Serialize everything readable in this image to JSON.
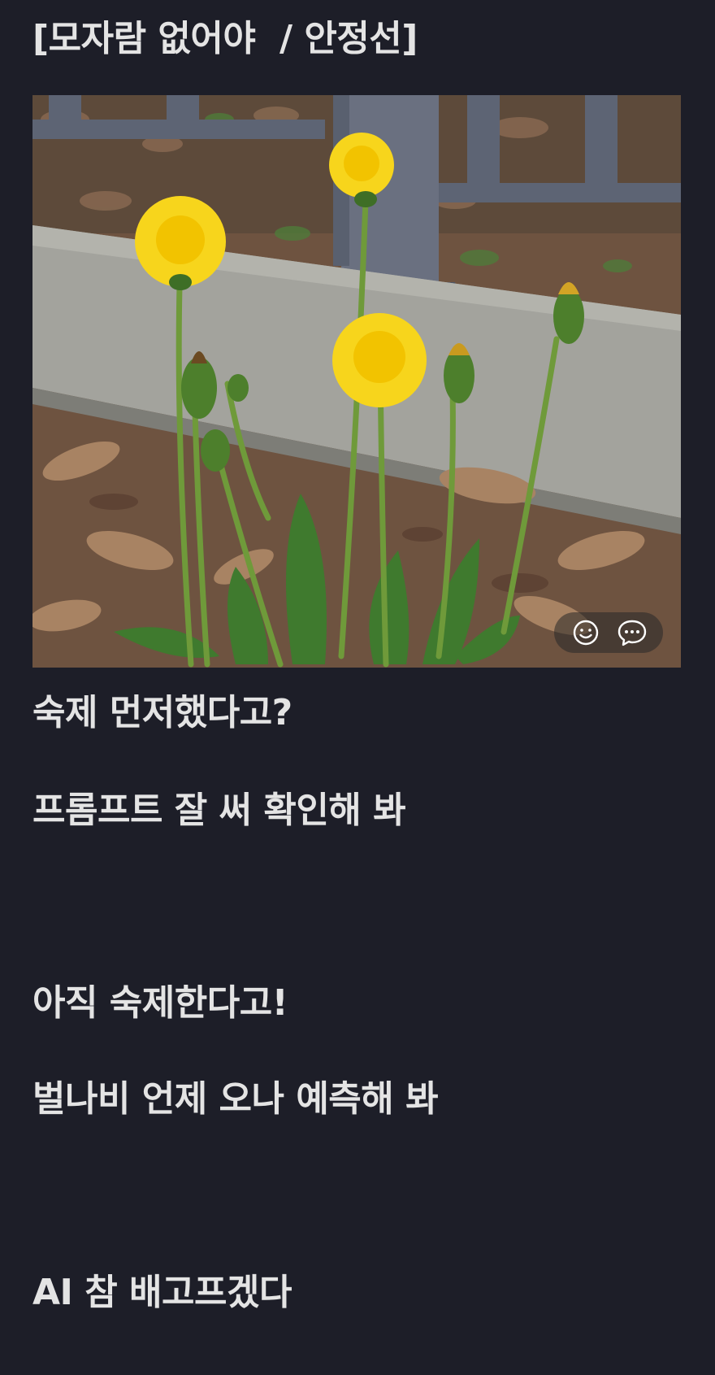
{
  "post": {
    "title": "[모자람 없어야  / 안정선]",
    "photo_alt": "dandelions",
    "lines": [
      "숙제 먼저했다고?",
      "프롬프트 잘 써 확인해 봐",
      "아직 숙제한다고!",
      "벌나비 언제 오나 예측해 봐",
      "AI 참 배고프겠다"
    ]
  },
  "reactions": {
    "emoji_icon": "smiley-icon",
    "comment_icon": "speech-bubble-icon"
  },
  "colors": {
    "background": "#1d1e28",
    "text": "#e4e4e4",
    "petal": "#f7d51c",
    "stem": "#6f9a3a"
  }
}
